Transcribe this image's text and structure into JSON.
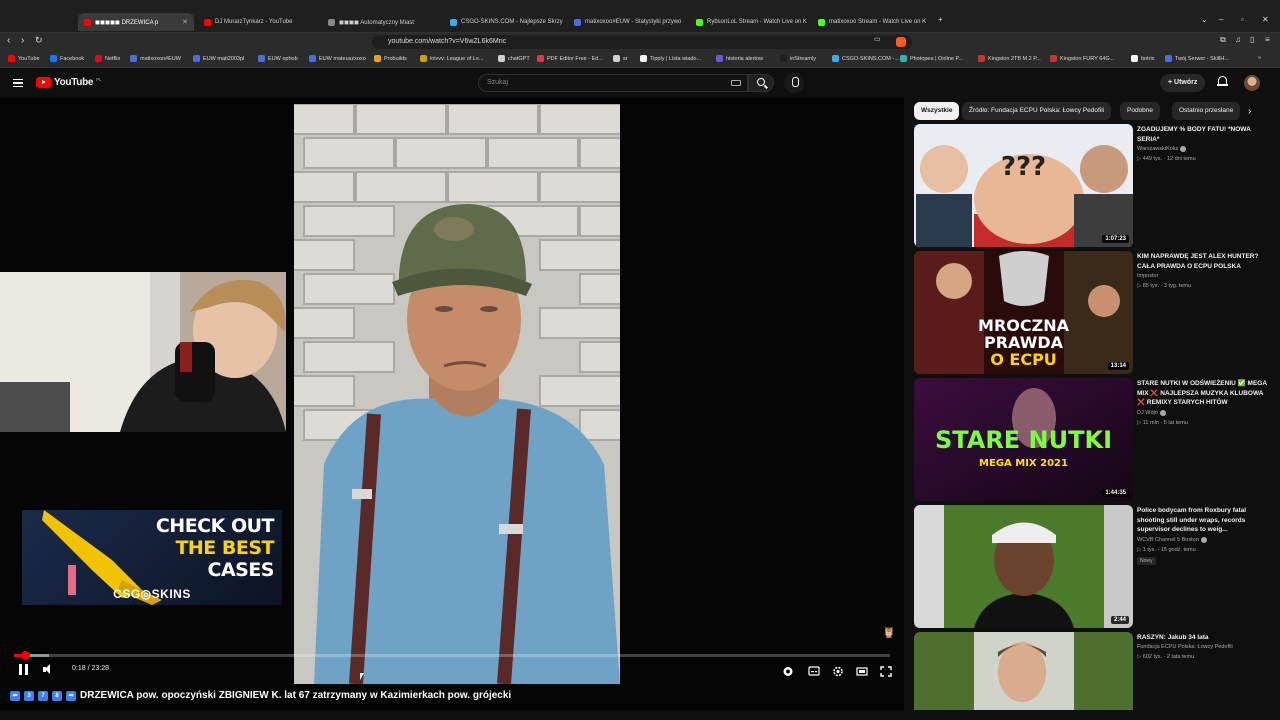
{
  "browser": {
    "tabs": [
      {
        "label": "◼◼◼◼◼ DRZEWICA p",
        "active": true
      },
      {
        "label": "DJ MurarzTynkarz - YouTube"
      },
      {
        "label": "◼◼◼◼ Automatyczny Miast"
      },
      {
        "label": "CSGO-SKINS.COM - Najlepsze Skrzy"
      },
      {
        "label": "matixoxoo#EUW - Statystyki przywo"
      },
      {
        "label": "RybsonLoL Stream - Watch Live on K"
      },
      {
        "label": "matixoxoo Stream - Watch Live on K"
      }
    ],
    "url": "youtube.com/watch?v=V6wZL6k6Mnc",
    "bookmarks": [
      "YouTube",
      "Facebook",
      "Netflix",
      "matixoxoo#EUW",
      "EUW mati2003pl",
      "EUW ophob",
      "EUW mateuszxoxo",
      "Probuilds",
      "loivvv: League of Le...",
      "chatGPT",
      "PDF Editor Free - Ed...",
      "sr",
      "Tipply | Lista wiado...",
      "historia alertow",
      "inStreamly",
      "CSGO-SKINS.COM -...",
      "Photopea | Online P...",
      "Kingston 2TB M.2 P...",
      "Kingston FURY 64G...",
      "botrix",
      "Twój Serwer - SkillH..."
    ]
  },
  "header": {
    "logo": "YouTube",
    "logo_region": "PL",
    "search_placeholder": "Szukaj",
    "create_label": "Utwórz"
  },
  "player": {
    "time_current": "0:18",
    "time_total": "23:28",
    "progress_fraction": 0.013,
    "buffer_fraction": 0.04,
    "ad": {
      "line1": "CHECK OUT",
      "line2": "THE BEST",
      "line3": "CASES",
      "brand": "CSG◎SKINS"
    }
  },
  "video_title": "DRZEWICA pow. opoczyński ZBIGNIEW K. lat 67 zatrzymany w Kazimierkach pow. grójecki",
  "title_emoji": [
    "⬅",
    "3",
    "7",
    "8",
    "➡"
  ],
  "chips": [
    "Wszystkie",
    "Źródło: Fundacja ECPU Polska: Łowcy Pedofili",
    "Podobne",
    "Ostatnio przesłane"
  ],
  "recommendations": [
    {
      "title": "ZGADUJEMY % BODY FATU! *NOWA SERIA*",
      "channel": "WarszawskiKoks",
      "verified": true,
      "views": "449 tys.",
      "age": "12 dni temu",
      "duration": "1:07:23",
      "thumb_text": "???"
    },
    {
      "title": "KIM NAPRAWDĘ JEST ALEX HUNTER? CAŁA PRAWDA O ECPU POLSKA",
      "channel": "Impostor",
      "verified": false,
      "views": "85 tys.",
      "age": "3 tyg. temu",
      "duration": "13:14",
      "thumb_line1": "MROCZNA",
      "thumb_line2": "PRAWDA",
      "thumb_line3": "O ECPU"
    },
    {
      "title": "STARE NUTKI W ODŚWIEŻENIU ✅ MEGA MIX ❌ NAJLEPSZA MUZYKA KLUBOWA ❌ REMIXY STARYCH HITÓW",
      "channel": "DJ Wójo",
      "verified": true,
      "views": "11 mln",
      "age": "5 lat temu",
      "duration": "1:44:35",
      "thumb_line1": "STARE NUTKI",
      "thumb_line2": "MEGA MIX 2021"
    },
    {
      "title": "Police bodycam from Roxbury fatal shooting still under wraps, records supervisor declines to weig...",
      "channel": "WCVB Channel 5 Boston",
      "verified": true,
      "views": "1 tys.",
      "age": "15 godz. temu",
      "duration": "2:44",
      "badge": "Nowy"
    },
    {
      "title": "RASZYN: Jakub 34 lata",
      "channel": "Fundacja ECPU Polska: Łowcy Pedofili",
      "verified": false,
      "views": "602 tys.",
      "age": "2 lata temu"
    }
  ],
  "colors": {
    "yt_red": "#ff0000",
    "bg": "#0f0f0f",
    "ad_yellow": "#ffd400"
  }
}
